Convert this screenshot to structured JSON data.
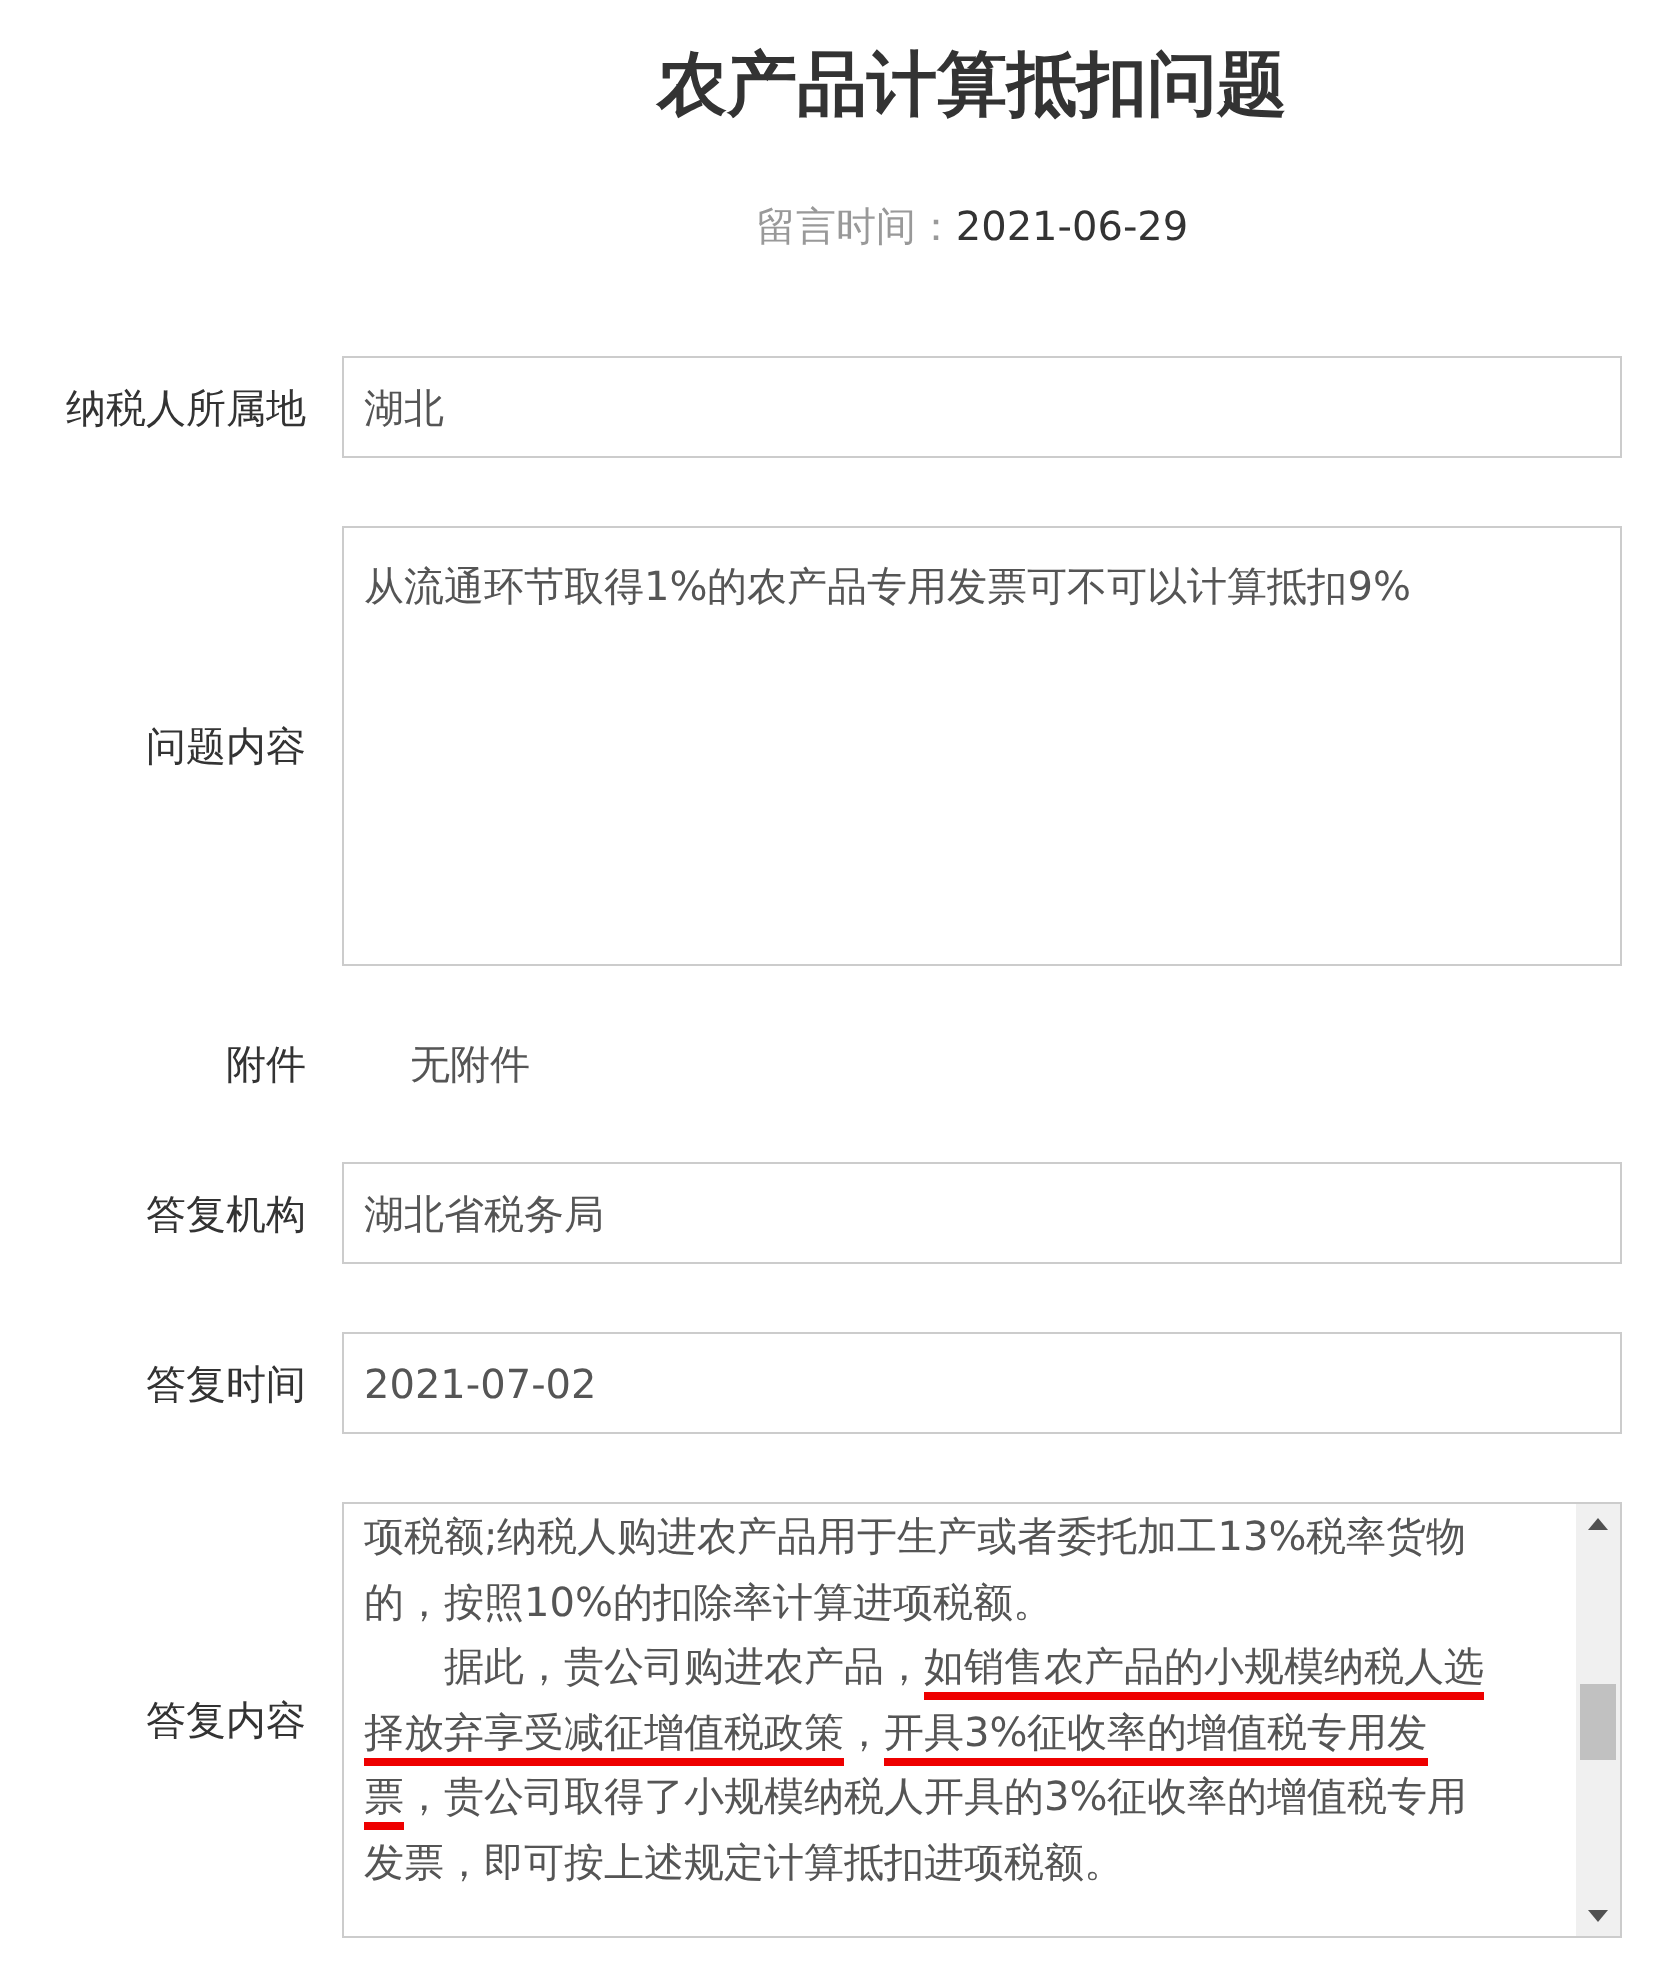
{
  "title": "农产品计算抵扣问题",
  "meta": {
    "label": "留言时间：",
    "value": "2021-06-29"
  },
  "fields": [
    {
      "kind": "input",
      "label": "纳税人所属地",
      "value": "湖北"
    },
    {
      "kind": "textarea",
      "label": "问题内容",
      "value": "从流通环节取得1%的农产品专用发票可不可以计算抵扣9%"
    },
    {
      "kind": "plain",
      "label": "附件",
      "value": "无附件"
    },
    {
      "kind": "input",
      "label": "答复机构",
      "value": "湖北省税务局"
    },
    {
      "kind": "input",
      "label": "答复时间",
      "value": "2021-07-02"
    },
    {
      "kind": "answer",
      "label": "答复内容",
      "paragraphs": [
        [
          {
            "text": "项税额;纳税人购进农产品用于生产或者委托加工13%税率货物的，按照10%的扣除率计算进项税额。",
            "underlined": false
          }
        ],
        [
          {
            "text": "据此，贵公司购进农产品，",
            "underlined": false
          },
          {
            "text": "如销售农产品的小规模纳税人选择放弃享受减征增值税政策",
            "underlined": true
          },
          {
            "text": "，",
            "underlined": false
          },
          {
            "text": "开具3%征收率的增值税专用发票",
            "underlined": true
          },
          {
            "text": "，贵公司取得了小规模纳税人开具的3%征收率的增值税专用发票，即可按上述规定计算抵扣进项税额。",
            "underlined": false
          }
        ]
      ]
    }
  ]
}
